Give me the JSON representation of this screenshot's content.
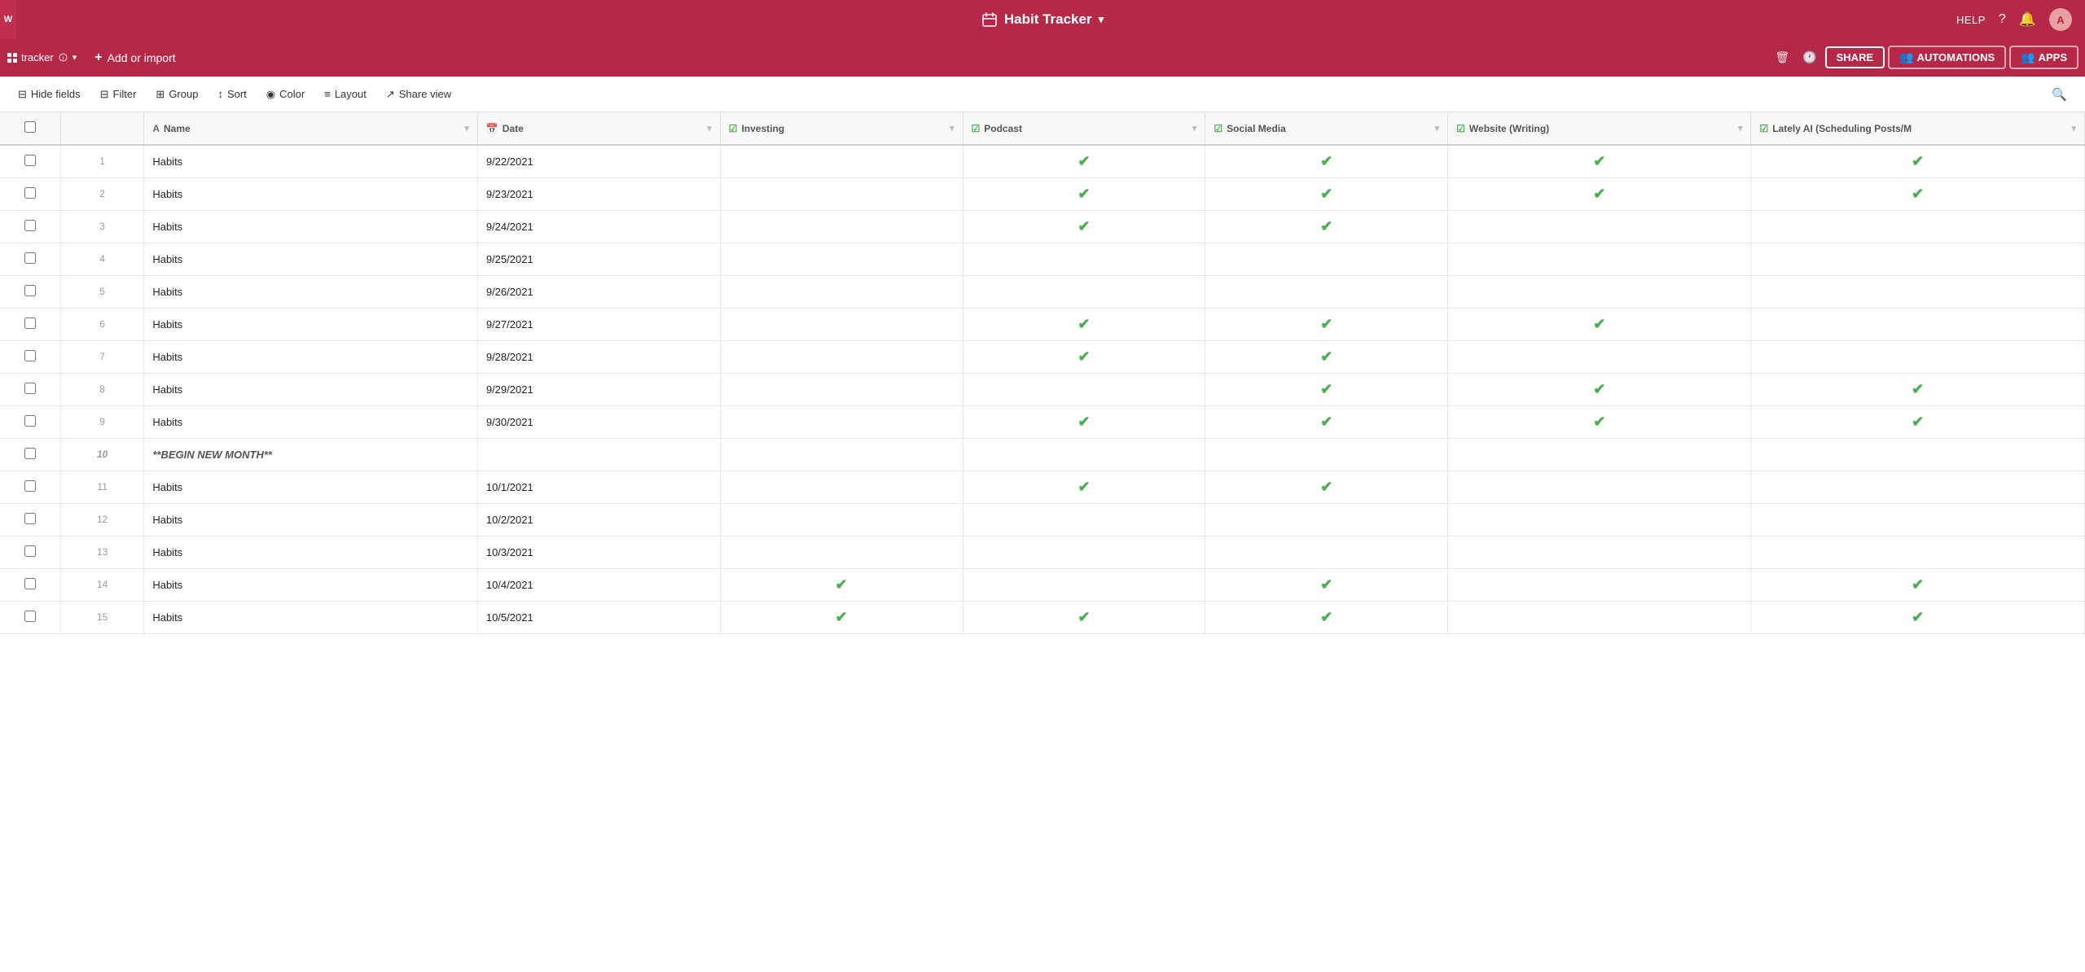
{
  "app": {
    "icon_label": "W",
    "title": "Habit Tracker",
    "title_dropdown": "▾",
    "help_label": "HELP",
    "notification_icon": "bell",
    "avatar_initials": "A"
  },
  "second_bar": {
    "view_label": "tracker",
    "view_icon": "grid",
    "add_import_label": "Add or import",
    "share_label": "SHARE",
    "automations_label": "AUTOMATIONS",
    "apps_label": "APPS",
    "delete_icon": "trash",
    "history_icon": "clock"
  },
  "toolbar": {
    "hide_fields_label": "Hide fields",
    "filter_label": "Filter",
    "group_label": "Group",
    "sort_label": "Sort",
    "color_label": "Color",
    "layout_label": "Layout",
    "share_view_label": "Share view",
    "search_icon": "search"
  },
  "columns": [
    {
      "id": "checkbox",
      "label": "",
      "type": "checkbox"
    },
    {
      "id": "row_num",
      "label": "",
      "type": "num"
    },
    {
      "id": "name",
      "label": "Name",
      "type": "text",
      "type_icon": "A"
    },
    {
      "id": "date",
      "label": "Date",
      "type": "date",
      "type_icon": "📅"
    },
    {
      "id": "investing",
      "label": "Investing",
      "type": "check",
      "type_icon": "☑"
    },
    {
      "id": "podcast",
      "label": "Podcast",
      "type": "check",
      "type_icon": "☑"
    },
    {
      "id": "social_media",
      "label": "Social Media",
      "type": "check",
      "type_icon": "☑"
    },
    {
      "id": "website",
      "label": "Website (Writing)",
      "type": "check",
      "type_icon": "☑"
    },
    {
      "id": "lately_ai",
      "label": "Lately AI (Scheduling Posts/M",
      "type": "check",
      "type_icon": "☑"
    }
  ],
  "rows": [
    {
      "num": 1,
      "name": "Habits",
      "date": "9/22/2021",
      "investing": false,
      "podcast": true,
      "social_media": true,
      "website": true,
      "lately_ai": true
    },
    {
      "num": 2,
      "name": "Habits",
      "date": "9/23/2021",
      "investing": false,
      "podcast": true,
      "social_media": true,
      "website": true,
      "lately_ai": true
    },
    {
      "num": 3,
      "name": "Habits",
      "date": "9/24/2021",
      "investing": false,
      "podcast": true,
      "social_media": true,
      "website": false,
      "lately_ai": false
    },
    {
      "num": 4,
      "name": "Habits",
      "date": "9/25/2021",
      "investing": false,
      "podcast": false,
      "social_media": false,
      "website": false,
      "lately_ai": false
    },
    {
      "num": 5,
      "name": "Habits",
      "date": "9/26/2021",
      "investing": false,
      "podcast": false,
      "social_media": false,
      "website": false,
      "lately_ai": false
    },
    {
      "num": 6,
      "name": "Habits",
      "date": "9/27/2021",
      "investing": false,
      "podcast": true,
      "social_media": true,
      "website": true,
      "lately_ai": false
    },
    {
      "num": 7,
      "name": "Habits",
      "date": "9/28/2021",
      "investing": false,
      "podcast": true,
      "social_media": true,
      "website": false,
      "lately_ai": false
    },
    {
      "num": 8,
      "name": "Habits",
      "date": "9/29/2021",
      "investing": false,
      "podcast": false,
      "social_media": true,
      "website": true,
      "lately_ai": true
    },
    {
      "num": 9,
      "name": "Habits",
      "date": "9/30/2021",
      "investing": false,
      "podcast": true,
      "social_media": true,
      "website": true,
      "lately_ai": true
    },
    {
      "num": 10,
      "name": "**BEGIN NEW MONTH**",
      "date": "",
      "investing": false,
      "podcast": false,
      "social_media": false,
      "website": false,
      "lately_ai": false,
      "special": true
    },
    {
      "num": 11,
      "name": "Habits",
      "date": "10/1/2021",
      "investing": false,
      "podcast": true,
      "social_media": true,
      "website": false,
      "lately_ai": false
    },
    {
      "num": 12,
      "name": "Habits",
      "date": "10/2/2021",
      "investing": false,
      "podcast": false,
      "social_media": false,
      "website": false,
      "lately_ai": false
    },
    {
      "num": 13,
      "name": "Habits",
      "date": "10/3/2021",
      "investing": false,
      "podcast": false,
      "social_media": false,
      "website": false,
      "lately_ai": false
    },
    {
      "num": 14,
      "name": "Habits",
      "date": "10/4/2021",
      "investing": true,
      "podcast": false,
      "social_media": true,
      "website": false,
      "lately_ai": true
    },
    {
      "num": 15,
      "name": "Habits",
      "date": "10/5/2021",
      "investing": true,
      "podcast": true,
      "social_media": true,
      "website": false,
      "lately_ai": true
    }
  ]
}
